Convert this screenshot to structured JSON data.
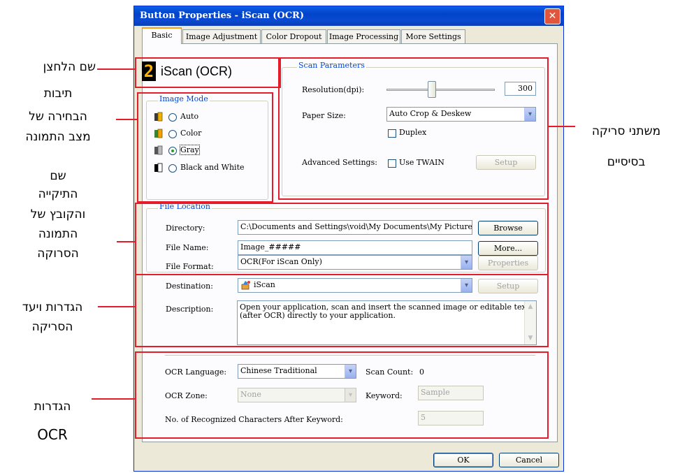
{
  "window": {
    "title": "Button Properties - iScan (OCR)",
    "close_glyph": "✕"
  },
  "tabs": [
    "Basic",
    "Image Adjustment",
    "Color Dropout",
    "Image Processing",
    "More Settings"
  ],
  "button_name": {
    "number": "2",
    "label": "iScan (OCR)"
  },
  "image_mode": {
    "title": "Image Mode",
    "options": [
      "Auto",
      "Color",
      "Gray",
      "Black and White"
    ],
    "selected": "Gray"
  },
  "scan_parameters": {
    "title": "Scan Parameters",
    "resolution_label": "Resolution(dpi):",
    "resolution_value": "300",
    "resolution_fraction": 0.42,
    "paper_size_label": "Paper Size:",
    "paper_size_value": "Auto Crop & Deskew",
    "duplex_label": "Duplex",
    "advanced_label": "Advanced Settings:",
    "use_twain_label": "Use TWAIN",
    "setup_label": "Setup"
  },
  "file_location": {
    "title": "File Location",
    "directory_label": "Directory:",
    "directory_value": "C:\\Documents and Settings\\void\\My Documents\\My Pictures",
    "browse_label": "Browse",
    "file_name_label": "File Name:",
    "file_name_value": "Image_#####",
    "more_label": "More...",
    "file_format_label": "File Format:",
    "file_format_value": "OCR(For iScan Only)",
    "properties_label": "Properties"
  },
  "destination": {
    "label": "Destination:",
    "value": "iScan",
    "setup_label": "Setup",
    "description_label": "Description:",
    "description_line1": "Open your application, scan and insert the scanned image or editable text",
    "description_line2": "(after OCR) directly to your application."
  },
  "ocr": {
    "language_label": "OCR Language:",
    "language_value": "Chinese Traditional",
    "scan_count_label": "Scan Count:",
    "scan_count_value": "0",
    "zone_label": "OCR Zone:",
    "zone_value": "None",
    "keyword_label": "Keyword:",
    "keyword_placeholder": "Sample",
    "recognized_label": "No. of Recognized Characters After Keyword:",
    "recognized_value": "5"
  },
  "footer": {
    "ok_label": "OK",
    "cancel_label": "Cancel"
  },
  "annotations": {
    "button_name": "שם הלחצן",
    "image_mode_1": "תיבות",
    "image_mode_2": "הבחירה של",
    "image_mode_3": "מצב התמונה",
    "file_location_1": "שם",
    "file_location_2": "התיקייה",
    "file_location_3": "והקובץ של",
    "file_location_4": "התמונה",
    "file_location_5": "הסרוקה",
    "destination_1": "הגדרות ויעד",
    "destination_2": "הסריקה",
    "ocr_1": "הגדרות",
    "ocr_2": "OCR",
    "scan_params_1": "משתני סריקה",
    "scan_params_2": "בסיסיים"
  },
  "colors": {
    "title_bar": "#0a4ad4",
    "annotation_red": "#e51d2a",
    "group_title": "#0046d5",
    "active_tab_highlight": "#f0a020"
  }
}
